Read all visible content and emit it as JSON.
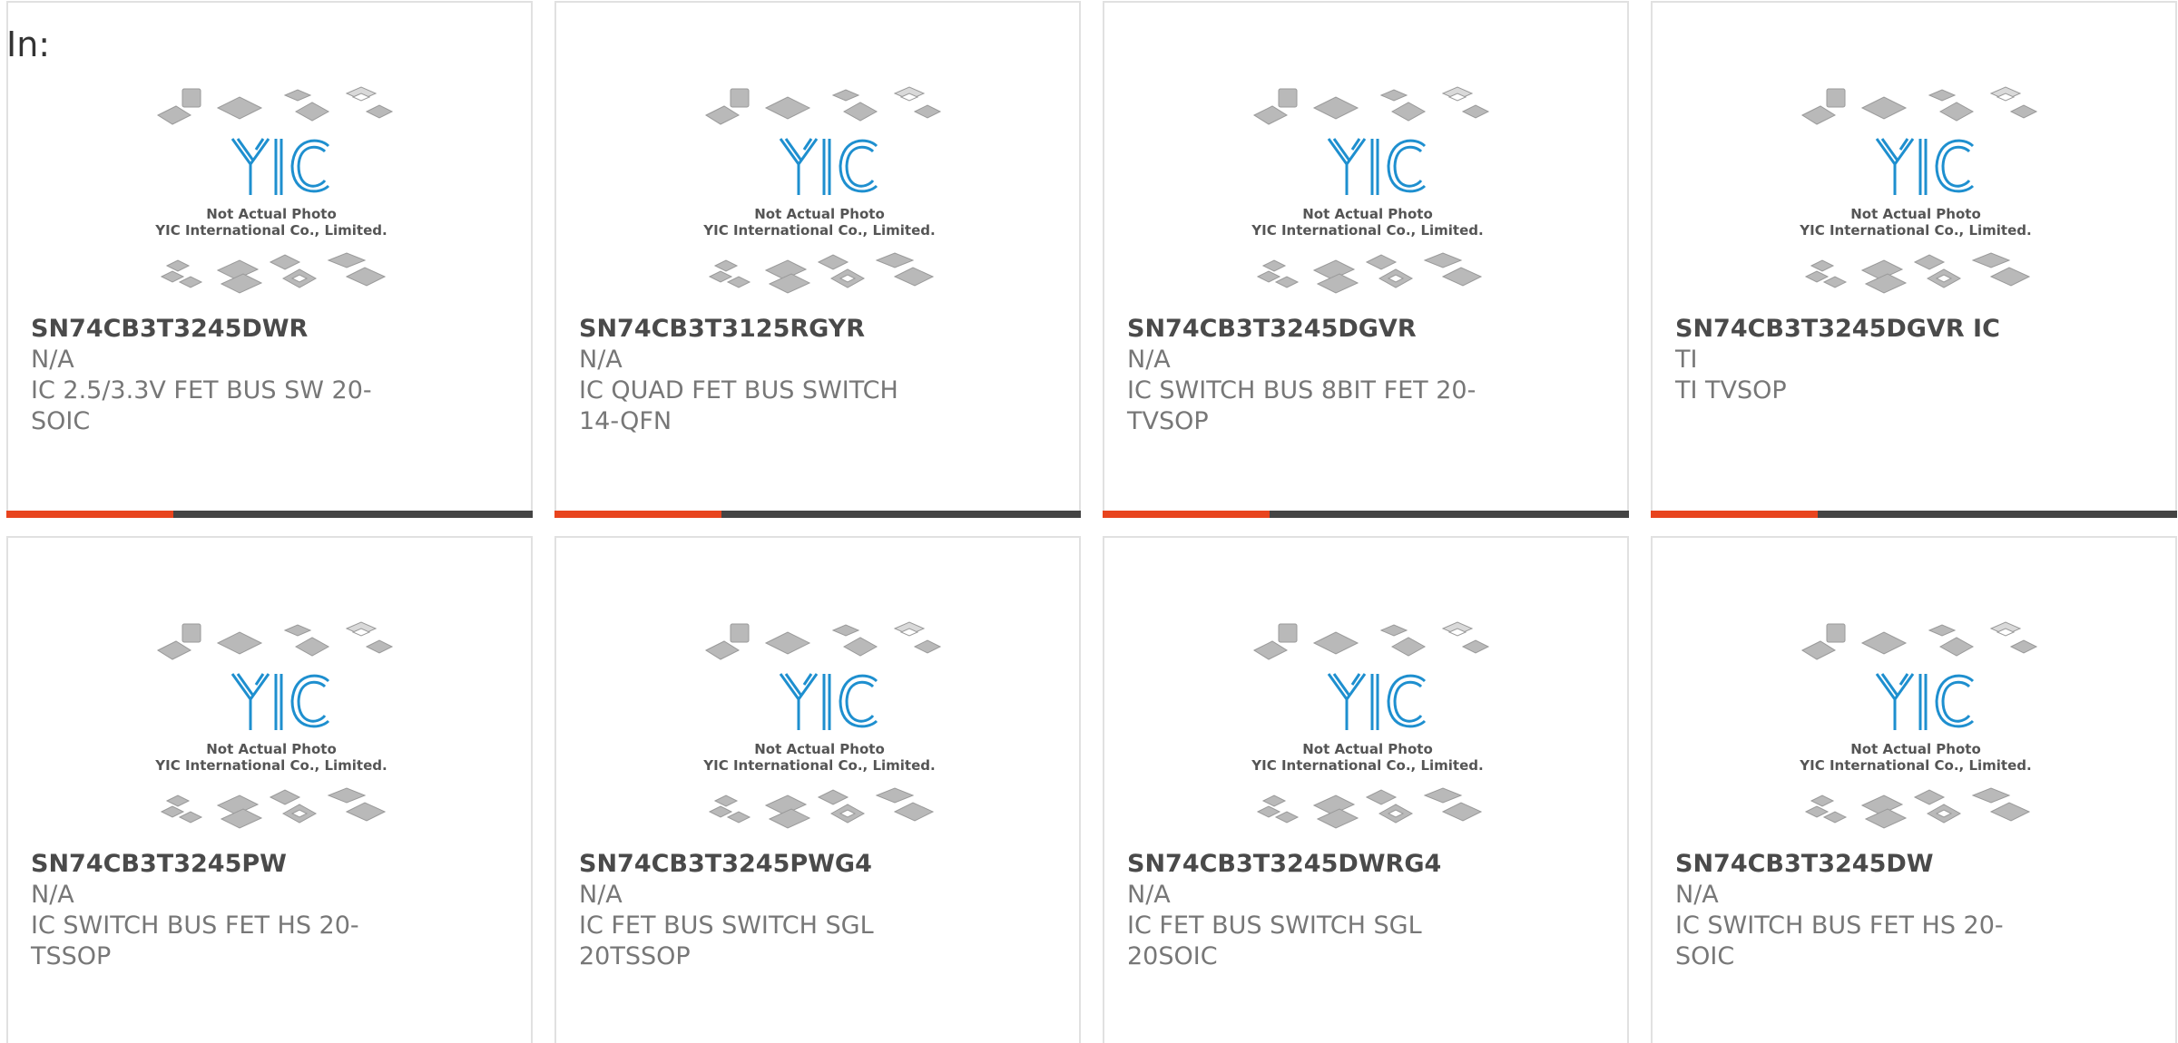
{
  "header": {
    "label": "In:"
  },
  "placeholder": {
    "line1": "Not Actual Photo",
    "line2": "YIC International Co., Limited.",
    "logo_text": "YIC"
  },
  "colors": {
    "accent": "#e8441e",
    "bar_dark": "#444444",
    "logo_blue": "#1e8fcf"
  },
  "products": [
    {
      "part": "SN74CB3T3245DWR",
      "manufacturer": "N/A",
      "description": "IC 2.5/3.3V FET BUS SW 20-SOIC"
    },
    {
      "part": "SN74CB3T3125RGYR",
      "manufacturer": "N/A",
      "description": "IC QUAD FET BUS SWITCH 14-QFN"
    },
    {
      "part": "SN74CB3T3245DGVR",
      "manufacturer": "N/A",
      "description": "IC SWITCH BUS 8BIT FET 20-TVSOP"
    },
    {
      "part": "SN74CB3T3245DGVR IC",
      "manufacturer": "TI",
      "description": "TI TVSOP"
    },
    {
      "part": "SN74CB3T3245PW",
      "manufacturer": "N/A",
      "description": "IC SWITCH BUS FET HS 20-TSSOP"
    },
    {
      "part": "SN74CB3T3245PWG4",
      "manufacturer": "N/A",
      "description": "IC FET BUS SWITCH SGL 20TSSOP"
    },
    {
      "part": "SN74CB3T3245DWRG4",
      "manufacturer": "N/A",
      "description": "IC FET BUS SWITCH SGL 20SOIC"
    },
    {
      "part": "SN74CB3T3245DW",
      "manufacturer": "N/A",
      "description": "IC SWITCH BUS FET HS 20-SOIC"
    }
  ]
}
